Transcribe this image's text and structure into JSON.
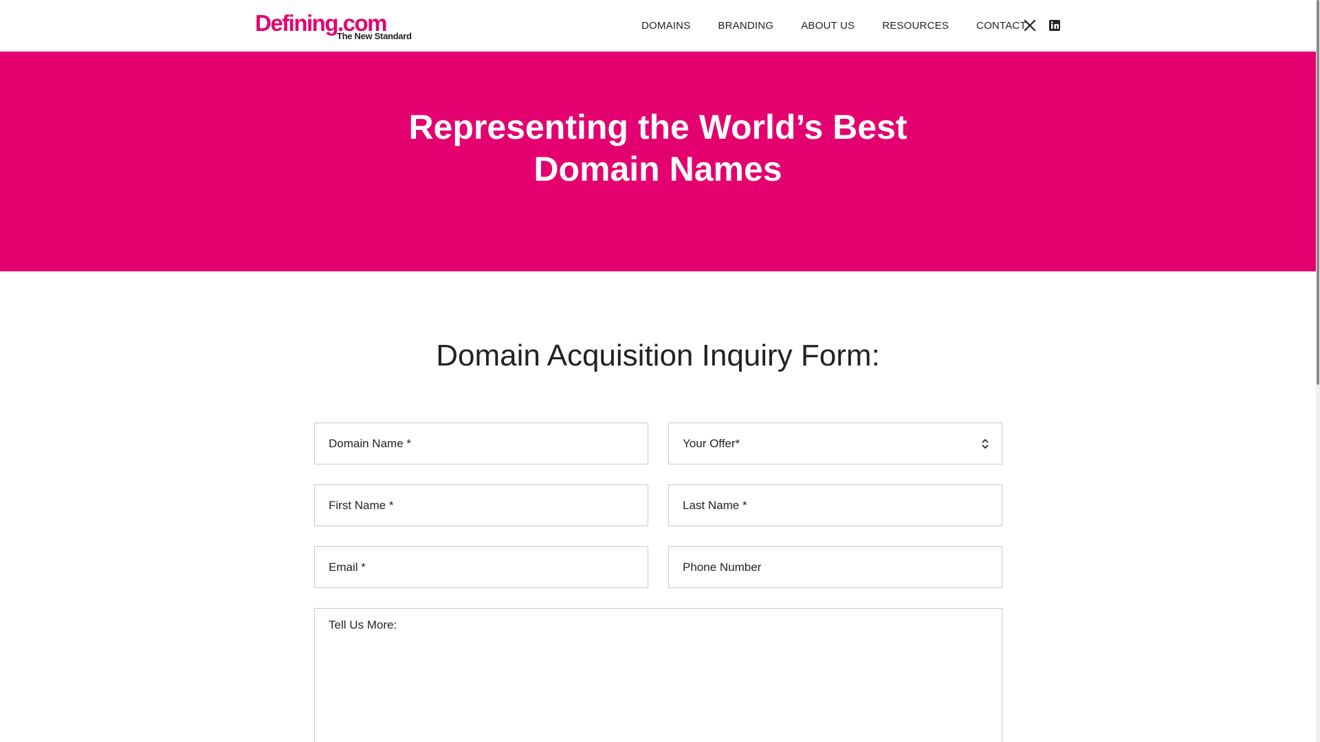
{
  "header": {
    "logo": {
      "name": "Defining.com",
      "tagline": "The New Standard"
    },
    "nav": [
      {
        "label": "DOMAINS"
      },
      {
        "label": "BRANDING"
      },
      {
        "label": "ABOUT US"
      },
      {
        "label": "RESOURCES"
      },
      {
        "label": "CONTACT"
      }
    ],
    "social": [
      {
        "icon": "x-twitter-icon"
      },
      {
        "icon": "linkedin-icon"
      }
    ]
  },
  "hero": {
    "title": "Representing the World’s Best Domain Names",
    "background_color": "#e4006f"
  },
  "form": {
    "title": "Domain Acquisition Inquiry Form:",
    "fields": {
      "domain_name": {
        "placeholder": "Domain Name *",
        "value": ""
      },
      "your_offer": {
        "label": "Your Offer*"
      },
      "first_name": {
        "placeholder": "First Name *",
        "value": ""
      },
      "last_name": {
        "placeholder": "Last Name *",
        "value": ""
      },
      "email": {
        "placeholder": "Email *",
        "value": ""
      },
      "phone": {
        "placeholder": "Phone Number",
        "value": ""
      },
      "message": {
        "placeholder": "Tell Us More:",
        "value": ""
      }
    }
  },
  "colors": {
    "brand": "#e4006f",
    "text": "#222222",
    "field_border": "#c9c9c9"
  }
}
